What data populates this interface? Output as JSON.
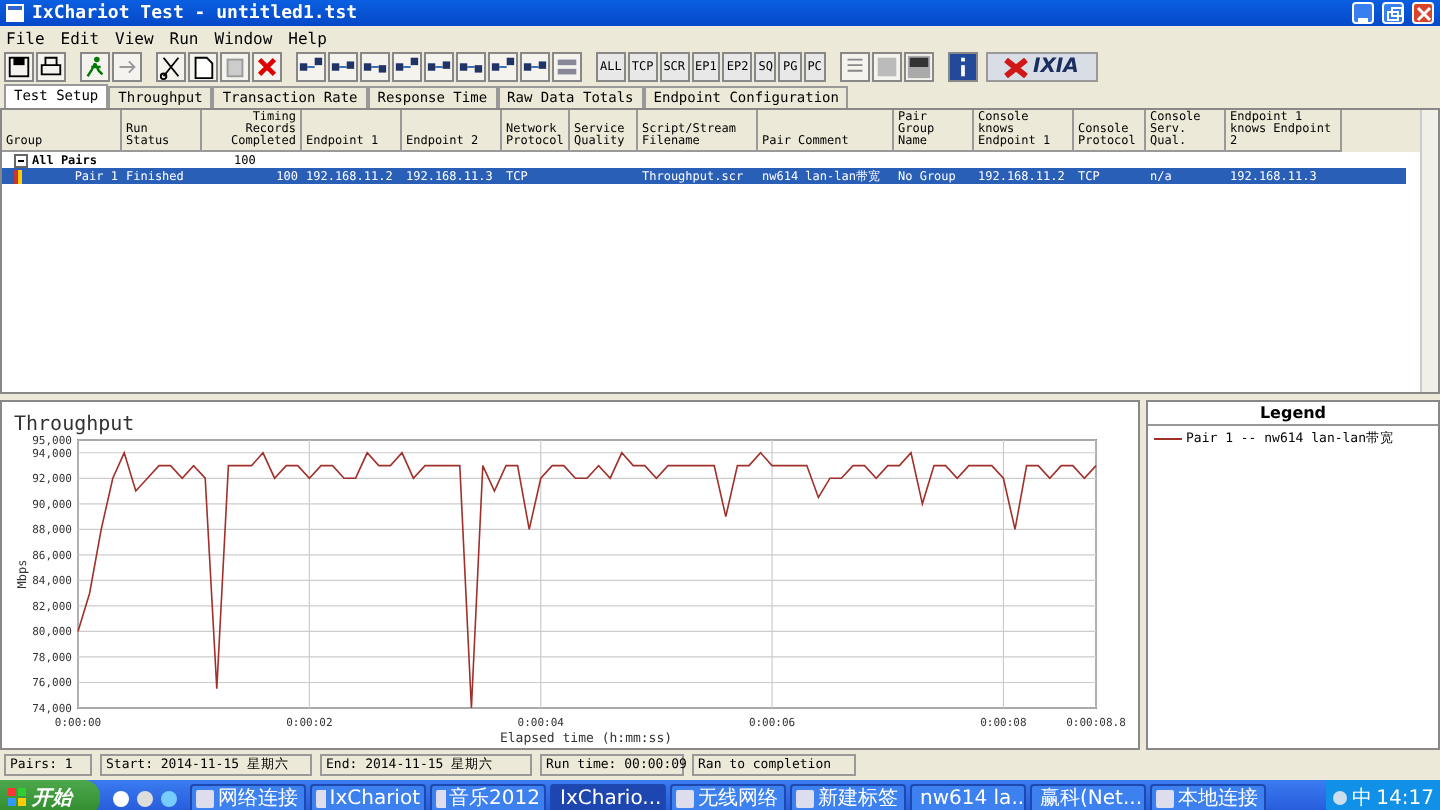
{
  "window": {
    "title": "IxChariot Test - untitled1.tst"
  },
  "menu": [
    "File",
    "Edit",
    "View",
    "Run",
    "Window",
    "Help"
  ],
  "toolbar": {
    "filters": [
      "ALL",
      "TCP",
      "SCR",
      "EP1",
      "EP2",
      "SQ",
      "PG",
      "PC"
    ],
    "logo": "IXIA"
  },
  "tabs": [
    {
      "label": "Test Setup",
      "selected": true
    },
    {
      "label": "Throughput",
      "selected": false
    },
    {
      "label": "Transaction Rate",
      "selected": false
    },
    {
      "label": "Response Time",
      "selected": false
    },
    {
      "label": "Raw Data Totals",
      "selected": false
    },
    {
      "label": "Endpoint Configuration",
      "selected": false
    }
  ],
  "table": {
    "columns": [
      "Group",
      "Run Status",
      "Timing Records Completed",
      "Endpoint 1",
      "Endpoint 2",
      "Network Protocol",
      "Service Quality",
      "Script/Stream Filename",
      "Pair Comment",
      "Pair Group Name",
      "Console knows Endpoint 1",
      "Console Protocol",
      "Console Serv. Qual.",
      "Endpoint 1 knows Endpoint 2"
    ],
    "group": {
      "label": "All Pairs",
      "expanded": true,
      "records": "100"
    },
    "rows": [
      {
        "selected": true,
        "cells": [
          "Pair 1",
          "Finished",
          "100",
          "192.168.11.2",
          "192.168.11.3",
          "TCP",
          "",
          "Throughput.scr",
          "nw614 lan-lan带宽",
          "No Group",
          "192.168.11.2",
          "TCP",
          "n/a",
          "192.168.11.3"
        ]
      }
    ]
  },
  "chart_data": {
    "type": "line",
    "title": "Throughput",
    "xlabel": "Elapsed time (h:mm:ss)",
    "ylabel": "Mbps",
    "xlim": [
      0,
      8.8
    ],
    "ylim": [
      74000,
      95000
    ],
    "grid": true,
    "x": [
      0,
      0.1,
      0.2,
      0.3,
      0.4,
      0.5,
      0.6,
      0.7,
      0.8,
      0.9,
      1,
      1.1,
      1.2,
      1.3,
      1.4,
      1.5,
      1.6,
      1.7,
      1.8,
      1.9,
      2,
      2.1,
      2.2,
      2.3,
      2.4,
      2.5,
      2.6,
      2.7,
      2.8,
      2.9,
      3,
      3.1,
      3.2,
      3.3,
      3.4,
      3.5,
      3.6,
      3.7,
      3.8,
      3.9,
      4,
      4.1,
      4.2,
      4.3,
      4.4,
      4.5,
      4.6,
      4.7,
      4.8,
      4.9,
      5,
      5.1,
      5.2,
      5.3,
      5.4,
      5.5,
      5.6,
      5.7,
      5.8,
      5.9,
      6,
      6.1,
      6.2,
      6.3,
      6.4,
      6.5,
      6.6,
      6.7,
      6.8,
      6.9,
      7,
      7.1,
      7.2,
      7.3,
      7.4,
      7.5,
      7.6,
      7.7,
      7.8,
      7.9,
      8,
      8.1,
      8.2,
      8.3,
      8.4,
      8.5,
      8.6,
      8.7,
      8.8
    ],
    "series": [
      {
        "name": "Pair 1 -- nw614 lan-lan带宽",
        "color": "#a0302a",
        "values": [
          80000,
          83000,
          88000,
          92000,
          94000,
          91000,
          92000,
          93000,
          93000,
          92000,
          93000,
          92000,
          75500,
          93000,
          93000,
          93000,
          94000,
          92000,
          93000,
          93000,
          92000,
          93000,
          93000,
          92000,
          92000,
          94000,
          93000,
          93000,
          94000,
          92000,
          93000,
          93000,
          93000,
          93000,
          74000,
          93000,
          91000,
          93000,
          93000,
          88000,
          92000,
          93000,
          93000,
          92000,
          92000,
          93000,
          92000,
          94000,
          93000,
          93000,
          92000,
          93000,
          93000,
          93000,
          93000,
          93000,
          89000,
          93000,
          93000,
          94000,
          93000,
          93000,
          93000,
          93000,
          90500,
          92000,
          92000,
          93000,
          93000,
          92000,
          93000,
          93000,
          94000,
          90000,
          93000,
          93000,
          92000,
          93000,
          93000,
          93000,
          92000,
          88000,
          93000,
          93000,
          92000,
          93000,
          93000,
          92000,
          93000
        ]
      }
    ],
    "xticks": [
      {
        "value": 0,
        "label": "0:00:00"
      },
      {
        "value": 2,
        "label": "0:00:02"
      },
      {
        "value": 4,
        "label": "0:00:04"
      },
      {
        "value": 6,
        "label": "0:00:06"
      },
      {
        "value": 8,
        "label": "0:00:08"
      },
      {
        "value": 8.8,
        "label": "0:00:08.8"
      }
    ],
    "yticks": [
      {
        "value": 74000,
        "label": "74,000"
      },
      {
        "value": 76000,
        "label": "76,000"
      },
      {
        "value": 78000,
        "label": "78,000"
      },
      {
        "value": 80000,
        "label": "80,000"
      },
      {
        "value": 82000,
        "label": "82,000"
      },
      {
        "value": 84000,
        "label": "84,000"
      },
      {
        "value": 86000,
        "label": "86,000"
      },
      {
        "value": 88000,
        "label": "88,000"
      },
      {
        "value": 90000,
        "label": "90,000"
      },
      {
        "value": 92000,
        "label": "92,000"
      },
      {
        "value": 94000,
        "label": "94,000"
      },
      {
        "value": 95000,
        "label": "95,000"
      }
    ]
  },
  "legend": {
    "title": "Legend"
  },
  "status_bar": [
    "Pairs: 1",
    "Start: 2014-11-15 星期六",
    "End: 2014-11-15 星期六",
    "Run time: 00:00:09",
    "Ran to completion"
  ],
  "taskbar": {
    "start": "开始",
    "tasks": [
      {
        "label": "网络连接",
        "selected": false
      },
      {
        "label": "IxChariot",
        "selected": false
      },
      {
        "label": "音乐2012",
        "selected": false
      },
      {
        "label": "IxChario...",
        "selected": true
      },
      {
        "label": "无线网络",
        "selected": false
      },
      {
        "label": "新建标签",
        "selected": false
      },
      {
        "label": "nw614 la...",
        "selected": false
      },
      {
        "label": "赢科(Net...",
        "selected": false
      },
      {
        "label": "本地连接",
        "selected": false
      }
    ],
    "ime": "中",
    "clock": "14:17"
  }
}
